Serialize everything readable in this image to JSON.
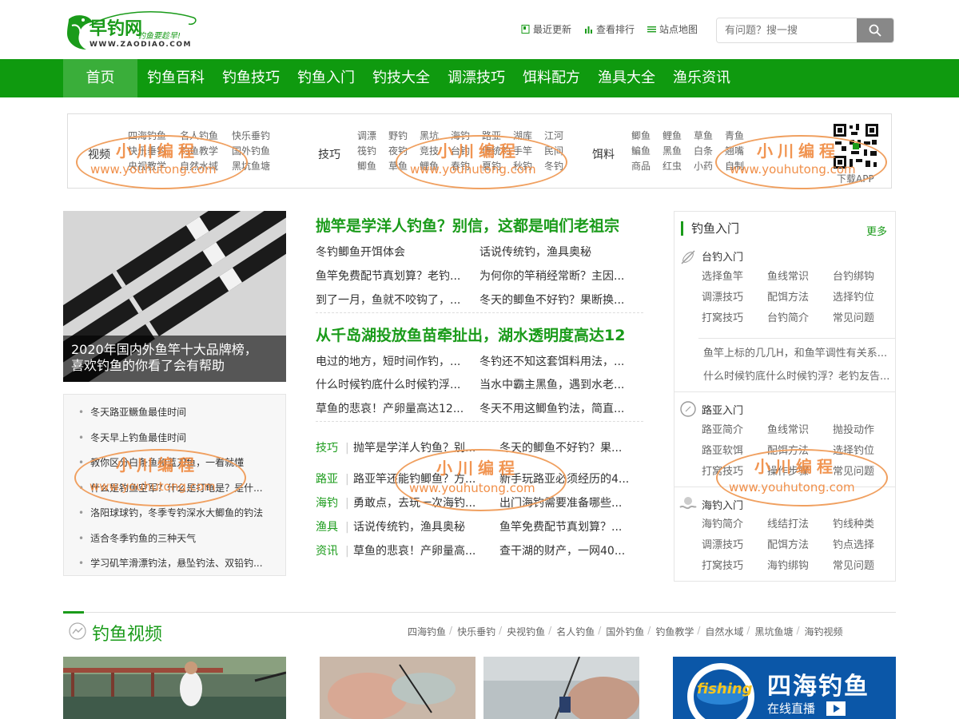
{
  "header": {
    "logo_text": "早钓网",
    "logo_slogan": "钓鱼要趁早!",
    "logo_url": "WWW.ZAODIAO.COM",
    "top_links": [
      "最近更新",
      "查看排行",
      "站点地图"
    ],
    "search_placeholder": "有问题？搜一搜"
  },
  "nav": {
    "home": "首页",
    "items": [
      "钓鱼百科",
      "钓鱼技巧",
      "钓鱼入门",
      "钓技大全",
      "调漂技巧",
      "饵料配方",
      "渔具大全",
      "渔乐资讯"
    ]
  },
  "categories": {
    "video": {
      "title": "视频",
      "items": [
        "四海钓鱼",
        "名人钓鱼",
        "快乐垂钓",
        "快乐垂钓",
        "钓鱼教学",
        "国外钓鱼",
        "央视教学",
        "自然水域",
        "黑坑鱼塘"
      ]
    },
    "skills": {
      "title": "技巧",
      "items": [
        "调漂",
        "野钓",
        "黑坑",
        "海钓",
        "路亚",
        "湖库",
        "江河",
        "筏钓",
        "夜钓",
        "竞技",
        "台钓",
        "传统钓",
        "手竿",
        "民间",
        "鲫鱼",
        "草鱼",
        "鲤鱼",
        "春钓",
        "夏钓",
        "秋钓",
        "冬钓"
      ]
    },
    "bait": {
      "title": "饵料",
      "items": [
        "鲫鱼",
        "鲤鱼",
        "草鱼",
        "青鱼",
        "鳊鱼",
        "黑鱼",
        "白条",
        "翘嘴",
        "商品",
        "红虫",
        "小药",
        "自制"
      ]
    },
    "app_label": "下载APP",
    "watermark_name": "小川编程",
    "watermark_url": "www.youhutong.com"
  },
  "feature": {
    "caption_line1": "2020年国内外鱼竿十大品牌榜，",
    "caption_line2": "喜欢钓鱼的你看了会有帮助"
  },
  "left_list": [
    "冬天路亚鳜鱼最佳时间",
    "冬天早上钓鱼最佳时间",
    "教你区分白条鱼和蓝刀鱼，一看就懂",
    "什么是钓鱼空军？什么是打龟是？是什...",
    "洛阳球球钓，冬季专钓深水大鲫鱼的钓法",
    "适合冬季钓鱼的三种天气",
    "学习矶竿滑漂钓法，悬坠钓法、双铅钓..."
  ],
  "middle": {
    "headline1": "抛竿是学洋人钓鱼？别信，这都是咱们老祖宗",
    "group1": [
      [
        "冬钓鲫鱼开饵体会",
        "话说传统钓，渔具奥秘"
      ],
      [
        "鱼竿免费配节真划算？老钓...",
        "为何你的竿稍经常断？主因..."
      ],
      [
        "到了一月，鱼就不咬钩了，...",
        "冬天的鲫鱼不好钓？果断换..."
      ]
    ],
    "headline2": "从千岛湖投放鱼苗牵扯出，湖水透明度高达12",
    "group2": [
      [
        "电过的地方，短时间作钓，...",
        "冬钓还不知这套饵料用法，..."
      ],
      [
        "什么时候钓底什么时候钓浮...",
        "当水中霸主黑鱼，遇到水老..."
      ],
      [
        "草鱼的悲哀！产卵量高达12...",
        "冬天不用这鲫鱼钓法，简直..."
      ]
    ],
    "tag_rows": [
      {
        "tag": "技巧",
        "a": "抛竿是学洋人钓鱼？别...",
        "b": "冬天的鲫鱼不好钓？果..."
      },
      {
        "tag": "路亚",
        "a": "路亚竿还能钓鲫鱼？方...",
        "b": "新手玩路亚必须经历的4..."
      },
      {
        "tag": "海钓",
        "a": "勇敢点，去玩一次海钓...",
        "b": "出门海钓需要准备哪些..."
      },
      {
        "tag": "渔具",
        "a": "话说传统钓，渔具奥秘",
        "b": "鱼竿免费配节真划算？..."
      },
      {
        "tag": "资讯",
        "a": "草鱼的悲哀！产卵量高...",
        "b": "查干湖的财产，一网40..."
      }
    ]
  },
  "right": {
    "title": "钓鱼入门",
    "more": "更多",
    "sec1": {
      "title": "台钓入门",
      "items": [
        "选择鱼竿",
        "鱼线常识",
        "台钓绑钩",
        "调漂技巧",
        "配饵方法",
        "选择钓位",
        "打窝技巧",
        "台钓简介",
        "常见问题"
      ],
      "lines": [
        "鱼竿上标的几几H，和鱼竿调性有关系...",
        "什么时候钓底什么时候钓浮？老钓友告..."
      ]
    },
    "sec2": {
      "title": "路亚入门",
      "items": [
        "路亚简介",
        "鱼线常识",
        "抛投动作",
        "路亚软饵",
        "配饵方法",
        "选择钓位",
        "打窝技巧",
        "操作步骤",
        "常见问题"
      ]
    },
    "sec3": {
      "title": "海钓入门",
      "items": [
        "海钓简介",
        "线结打法",
        "钓线种类",
        "调漂技巧",
        "配饵方法",
        "钓点选择",
        "打窝技巧",
        "海钓绑钩",
        "常见问题"
      ]
    }
  },
  "video_section": {
    "title": "钓鱼视频",
    "tags": [
      "四海钓鱼",
      "快乐垂钓",
      "央视钓鱼",
      "名人钓鱼",
      "国外钓鱼",
      "钓鱼教学",
      "自然水域",
      "黑坑鱼塘",
      "海钓视频"
    ],
    "thumb4_title": "四海钓鱼",
    "thumb4_sub": "在线直播",
    "thumb4_brand": "fishing"
  },
  "colors": {
    "brand_green": "#0f9a0f",
    "link_green": "#1a9b1a",
    "watermark": "#f08a40"
  }
}
